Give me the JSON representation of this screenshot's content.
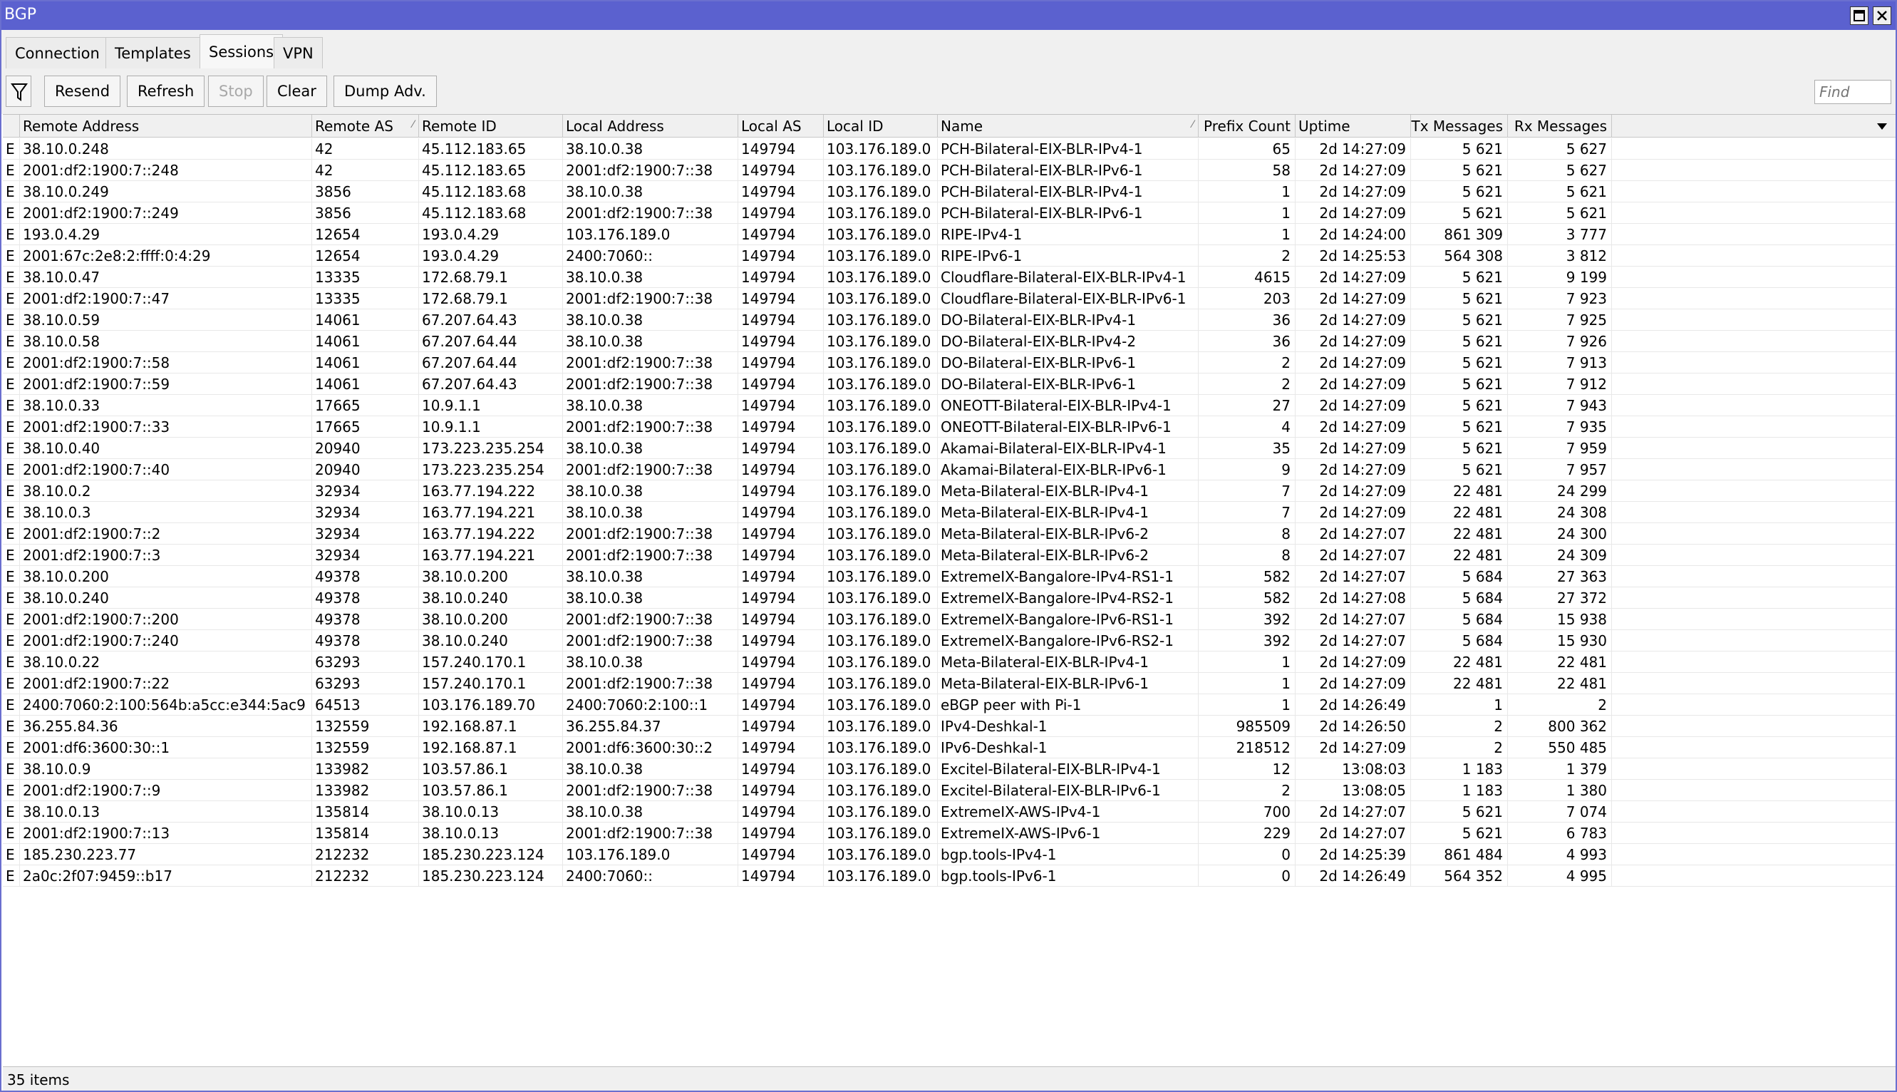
{
  "window": {
    "title": "BGP",
    "restore_icon": "restore-icon",
    "close_icon": "close-icon"
  },
  "tabs": [
    "Connection",
    "Templates",
    "Sessions",
    "VPN"
  ],
  "active_tab": "Sessions",
  "toolbar": {
    "filter_icon": "filter-icon",
    "buttons": [
      {
        "label": "Resend",
        "enabled": true
      },
      {
        "label": "Refresh",
        "enabled": true
      },
      {
        "label": "Stop",
        "enabled": false
      },
      {
        "label": "Clear",
        "enabled": true
      },
      {
        "label": "Dump Adv.",
        "enabled": true
      }
    ],
    "find_placeholder": "Find"
  },
  "columns": [
    "",
    "Remote Address",
    "Remote AS",
    "Remote ID",
    "Local Address",
    "Local AS",
    "Local ID",
    "Name",
    "Prefix Count",
    "Uptime",
    "Tx Messages",
    "Rx Messages"
  ],
  "rows": [
    [
      "E",
      "38.10.0.248",
      "42",
      "45.112.183.65",
      "38.10.0.38",
      "149794",
      "103.176.189.0",
      "PCH-Bilateral-EIX-BLR-IPv4-1",
      "65",
      "2d 14:27:09",
      "5 621",
      "5 627"
    ],
    [
      "E",
      "2001:df2:1900:7::248",
      "42",
      "45.112.183.65",
      "2001:df2:1900:7::38",
      "149794",
      "103.176.189.0",
      "PCH-Bilateral-EIX-BLR-IPv6-1",
      "58",
      "2d 14:27:09",
      "5 621",
      "5 627"
    ],
    [
      "E",
      "38.10.0.249",
      "3856",
      "45.112.183.68",
      "38.10.0.38",
      "149794",
      "103.176.189.0",
      "PCH-Bilateral-EIX-BLR-IPv4-1",
      "1",
      "2d 14:27:09",
      "5 621",
      "5 621"
    ],
    [
      "E",
      "2001:df2:1900:7::249",
      "3856",
      "45.112.183.68",
      "2001:df2:1900:7::38",
      "149794",
      "103.176.189.0",
      "PCH-Bilateral-EIX-BLR-IPv6-1",
      "1",
      "2d 14:27:09",
      "5 621",
      "5 621"
    ],
    [
      "E",
      "193.0.4.29",
      "12654",
      "193.0.4.29",
      "103.176.189.0",
      "149794",
      "103.176.189.0",
      "RIPE-IPv4-1",
      "1",
      "2d 14:24:00",
      "861 309",
      "3 777"
    ],
    [
      "E",
      "2001:67c:2e8:2:ffff:0:4:29",
      "12654",
      "193.0.4.29",
      "2400:7060::",
      "149794",
      "103.176.189.0",
      "RIPE-IPv6-1",
      "2",
      "2d 14:25:53",
      "564 308",
      "3 812"
    ],
    [
      "E",
      "38.10.0.47",
      "13335",
      "172.68.79.1",
      "38.10.0.38",
      "149794",
      "103.176.189.0",
      "Cloudflare-Bilateral-EIX-BLR-IPv4-1",
      "4615",
      "2d 14:27:09",
      "5 621",
      "9 199"
    ],
    [
      "E",
      "2001:df2:1900:7::47",
      "13335",
      "172.68.79.1",
      "2001:df2:1900:7::38",
      "149794",
      "103.176.189.0",
      "Cloudflare-Bilateral-EIX-BLR-IPv6-1",
      "203",
      "2d 14:27:09",
      "5 621",
      "7 923"
    ],
    [
      "E",
      "38.10.0.59",
      "14061",
      "67.207.64.43",
      "38.10.0.38",
      "149794",
      "103.176.189.0",
      "DO-Bilateral-EIX-BLR-IPv4-1",
      "36",
      "2d 14:27:09",
      "5 621",
      "7 925"
    ],
    [
      "E",
      "38.10.0.58",
      "14061",
      "67.207.64.44",
      "38.10.0.38",
      "149794",
      "103.176.189.0",
      "DO-Bilateral-EIX-BLR-IPv4-2",
      "36",
      "2d 14:27:09",
      "5 621",
      "7 926"
    ],
    [
      "E",
      "2001:df2:1900:7::58",
      "14061",
      "67.207.64.44",
      "2001:df2:1900:7::38",
      "149794",
      "103.176.189.0",
      "DO-Bilateral-EIX-BLR-IPv6-1",
      "2",
      "2d 14:27:09",
      "5 621",
      "7 913"
    ],
    [
      "E",
      "2001:df2:1900:7::59",
      "14061",
      "67.207.64.43",
      "2001:df2:1900:7::38",
      "149794",
      "103.176.189.0",
      "DO-Bilateral-EIX-BLR-IPv6-1",
      "2",
      "2d 14:27:09",
      "5 621",
      "7 912"
    ],
    [
      "E",
      "38.10.0.33",
      "17665",
      "10.9.1.1",
      "38.10.0.38",
      "149794",
      "103.176.189.0",
      "ONEOTT-Bilateral-EIX-BLR-IPv4-1",
      "27",
      "2d 14:27:09",
      "5 621",
      "7 943"
    ],
    [
      "E",
      "2001:df2:1900:7::33",
      "17665",
      "10.9.1.1",
      "2001:df2:1900:7::38",
      "149794",
      "103.176.189.0",
      "ONEOTT-Bilateral-EIX-BLR-IPv6-1",
      "4",
      "2d 14:27:09",
      "5 621",
      "7 935"
    ],
    [
      "E",
      "38.10.0.40",
      "20940",
      "173.223.235.254",
      "38.10.0.38",
      "149794",
      "103.176.189.0",
      "Akamai-Bilateral-EIX-BLR-IPv4-1",
      "35",
      "2d 14:27:09",
      "5 621",
      "7 959"
    ],
    [
      "E",
      "2001:df2:1900:7::40",
      "20940",
      "173.223.235.254",
      "2001:df2:1900:7::38",
      "149794",
      "103.176.189.0",
      "Akamai-Bilateral-EIX-BLR-IPv6-1",
      "9",
      "2d 14:27:09",
      "5 621",
      "7 957"
    ],
    [
      "E",
      "38.10.0.2",
      "32934",
      "163.77.194.222",
      "38.10.0.38",
      "149794",
      "103.176.189.0",
      "Meta-Bilateral-EIX-BLR-IPv4-1",
      "7",
      "2d 14:27:09",
      "22 481",
      "24 299"
    ],
    [
      "E",
      "38.10.0.3",
      "32934",
      "163.77.194.221",
      "38.10.0.38",
      "149794",
      "103.176.189.0",
      "Meta-Bilateral-EIX-BLR-IPv4-1",
      "7",
      "2d 14:27:09",
      "22 481",
      "24 308"
    ],
    [
      "E",
      "2001:df2:1900:7::2",
      "32934",
      "163.77.194.222",
      "2001:df2:1900:7::38",
      "149794",
      "103.176.189.0",
      "Meta-Bilateral-EIX-BLR-IPv6-2",
      "8",
      "2d 14:27:07",
      "22 481",
      "24 300"
    ],
    [
      "E",
      "2001:df2:1900:7::3",
      "32934",
      "163.77.194.221",
      "2001:df2:1900:7::38",
      "149794",
      "103.176.189.0",
      "Meta-Bilateral-EIX-BLR-IPv6-2",
      "8",
      "2d 14:27:07",
      "22 481",
      "24 309"
    ],
    [
      "E",
      "38.10.0.200",
      "49378",
      "38.10.0.200",
      "38.10.0.38",
      "149794",
      "103.176.189.0",
      "ExtremeIX-Bangalore-IPv4-RS1-1",
      "582",
      "2d 14:27:07",
      "5 684",
      "27 363"
    ],
    [
      "E",
      "38.10.0.240",
      "49378",
      "38.10.0.240",
      "38.10.0.38",
      "149794",
      "103.176.189.0",
      "ExtremeIX-Bangalore-IPv4-RS2-1",
      "582",
      "2d 14:27:08",
      "5 684",
      "27 372"
    ],
    [
      "E",
      "2001:df2:1900:7::200",
      "49378",
      "38.10.0.200",
      "2001:df2:1900:7::38",
      "149794",
      "103.176.189.0",
      "ExtremeIX-Bangalore-IPv6-RS1-1",
      "392",
      "2d 14:27:07",
      "5 684",
      "15 938"
    ],
    [
      "E",
      "2001:df2:1900:7::240",
      "49378",
      "38.10.0.240",
      "2001:df2:1900:7::38",
      "149794",
      "103.176.189.0",
      "ExtremeIX-Bangalore-IPv6-RS2-1",
      "392",
      "2d 14:27:07",
      "5 684",
      "15 930"
    ],
    [
      "E",
      "38.10.0.22",
      "63293",
      "157.240.170.1",
      "38.10.0.38",
      "149794",
      "103.176.189.0",
      "Meta-Bilateral-EIX-BLR-IPv4-1",
      "1",
      "2d 14:27:09",
      "22 481",
      "22 481"
    ],
    [
      "E",
      "2001:df2:1900:7::22",
      "63293",
      "157.240.170.1",
      "2001:df2:1900:7::38",
      "149794",
      "103.176.189.0",
      "Meta-Bilateral-EIX-BLR-IPv6-1",
      "1",
      "2d 14:27:09",
      "22 481",
      "22 481"
    ],
    [
      "E",
      "2400:7060:2:100:564b:a5cc:e344:5ac9",
      "64513",
      "103.176.189.70",
      "2400:7060:2:100::1",
      "149794",
      "103.176.189.0",
      "eBGP peer with Pi-1",
      "1",
      "2d 14:26:49",
      "1",
      "2"
    ],
    [
      "E",
      "36.255.84.36",
      "132559",
      "192.168.87.1",
      "36.255.84.37",
      "149794",
      "103.176.189.0",
      "IPv4-Deshkal-1",
      "985509",
      "2d 14:26:50",
      "2",
      "800 362"
    ],
    [
      "E",
      "2001:df6:3600:30::1",
      "132559",
      "192.168.87.1",
      "2001:df6:3600:30::2",
      "149794",
      "103.176.189.0",
      "IPv6-Deshkal-1",
      "218512",
      "2d 14:27:09",
      "2",
      "550 485"
    ],
    [
      "E",
      "38.10.0.9",
      "133982",
      "103.57.86.1",
      "38.10.0.38",
      "149794",
      "103.176.189.0",
      "Excitel-Bilateral-EIX-BLR-IPv4-1",
      "12",
      "13:08:03",
      "1 183",
      "1 379"
    ],
    [
      "E",
      "2001:df2:1900:7::9",
      "133982",
      "103.57.86.1",
      "2001:df2:1900:7::38",
      "149794",
      "103.176.189.0",
      "Excitel-Bilateral-EIX-BLR-IPv6-1",
      "2",
      "13:08:05",
      "1 183",
      "1 380"
    ],
    [
      "E",
      "38.10.0.13",
      "135814",
      "38.10.0.13",
      "38.10.0.38",
      "149794",
      "103.176.189.0",
      "ExtremeIX-AWS-IPv4-1",
      "700",
      "2d 14:27:07",
      "5 621",
      "7 074"
    ],
    [
      "E",
      "2001:df2:1900:7::13",
      "135814",
      "38.10.0.13",
      "2001:df2:1900:7::38",
      "149794",
      "103.176.189.0",
      "ExtremeIX-AWS-IPv6-1",
      "229",
      "2d 14:27:07",
      "5 621",
      "6 783"
    ],
    [
      "E",
      "185.230.223.77",
      "212232",
      "185.230.223.124",
      "103.176.189.0",
      "149794",
      "103.176.189.0",
      "bgp.tools-IPv4-1",
      "0",
      "2d 14:25:39",
      "861 484",
      "4 993"
    ],
    [
      "E",
      "2a0c:2f07:9459::b17",
      "212232",
      "185.230.223.124",
      "2400:7060::",
      "149794",
      "103.176.189.0",
      "bgp.tools-IPv6-1",
      "0",
      "2d 14:26:49",
      "564 352",
      "4 995"
    ]
  ],
  "status": {
    "items_count": "35 items"
  }
}
